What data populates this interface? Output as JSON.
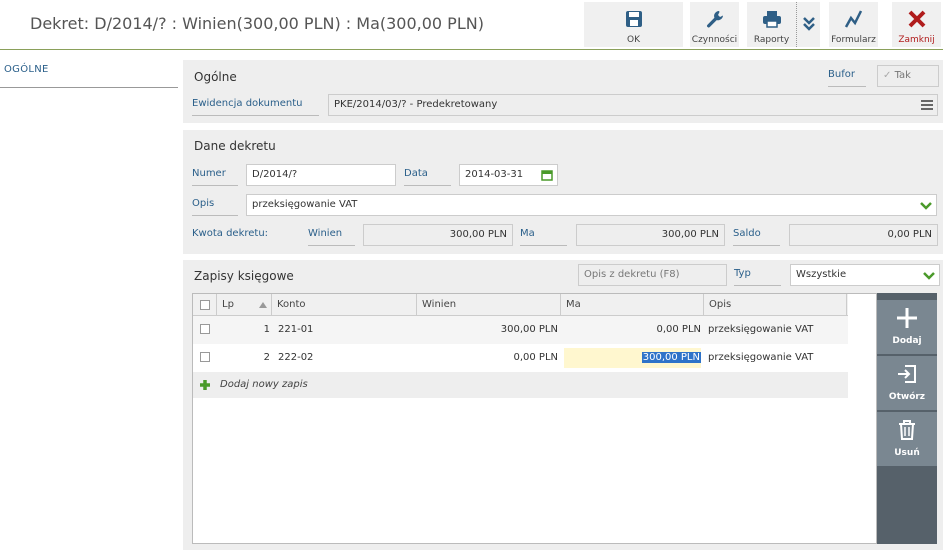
{
  "window": {
    "title": "Dekret: D/2014/? : Winien(300,00 PLN) : Ma(300,00 PLN)"
  },
  "toolbar": {
    "ok": "OK",
    "actions": "Czynności",
    "reports": "Raporty",
    "form": "Formularz",
    "close": "Zamknij"
  },
  "nav": {
    "items": [
      {
        "label": "OGÓLNE"
      }
    ]
  },
  "general": {
    "title": "Ogólne",
    "bufor_label": "Bufor",
    "bufor_value": "Tak",
    "ewidencja_label": "Ewidencja dokumentu",
    "ewidencja_value": "PKE/2014/03/? - Predekretowany"
  },
  "decree": {
    "title": "Dane dekretu",
    "numer_label": "Numer",
    "numer_value": "D/2014/?",
    "data_label": "Data",
    "data_value": "2014-03-31",
    "opis_label": "Opis",
    "opis_value": "przeksięgowanie VAT",
    "kwota_label": "Kwota dekretu:",
    "winien_label": "Winien",
    "winien_value": "300,00 PLN",
    "ma_label": "Ma",
    "ma_value": "300,00 PLN",
    "saldo_label": "Saldo",
    "saldo_value": "0,00 PLN"
  },
  "entries": {
    "title": "Zapisy księgowe",
    "opis_placeholder": "Opis z dekretu (F8)",
    "typ_label": "Typ",
    "typ_value": "Wszystkie",
    "columns": [
      "Lp",
      "Konto",
      "Winien",
      "Ma",
      "Opis"
    ],
    "rows": [
      {
        "lp": "1",
        "konto": "221-01",
        "winien": "300,00 PLN",
        "ma": "0,00 PLN",
        "opis": "przeksięgowanie VAT"
      },
      {
        "lp": "2",
        "konto": "222-02",
        "winien": "0,00 PLN",
        "ma": "300,00 PLN",
        "opis": "przeksięgowanie VAT"
      }
    ],
    "add_new": "Dodaj nowy zapis"
  },
  "side_actions": {
    "add": "Dodaj",
    "open": "Otwórz",
    "delete": "Usuń"
  },
  "colors": {
    "accent_green": "#8aa05a",
    "label_blue": "#2a5f8a",
    "close_red": "#b01c1c",
    "selection_blue": "#2f73c9",
    "edit_yellow": "#fff7cf"
  }
}
